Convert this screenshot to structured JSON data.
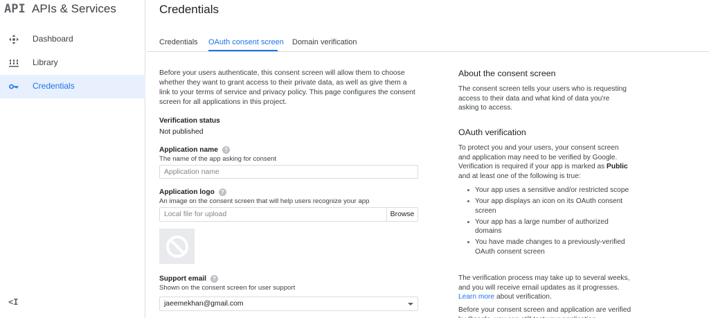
{
  "brand": {
    "logo": "API",
    "title": "APIs & Services"
  },
  "sidebar": {
    "items": [
      {
        "label": "Dashboard",
        "icon": "dashboard-icon"
      },
      {
        "label": "Library",
        "icon": "library-icon"
      },
      {
        "label": "Credentials",
        "icon": "key-icon",
        "active": true
      }
    ],
    "collapse_label": "<I"
  },
  "header": {
    "title": "Credentials"
  },
  "tabs": [
    {
      "label": "Credentials"
    },
    {
      "label": "OAuth consent screen",
      "active": true
    },
    {
      "label": "Domain verification"
    }
  ],
  "form": {
    "intro": "Before your users authenticate, this consent screen will allow them to choose whether they want to grant access to their private data, as well as give them a link to your terms of service and privacy policy. This page configures the consent screen for all applications in this project.",
    "verification_status_label": "Verification status",
    "verification_status_value": "Not published",
    "app_name_label": "Application name",
    "app_name_help": "The name of the app asking for consent",
    "app_name_placeholder": "Application name",
    "app_name_value": "",
    "app_logo_label": "Application logo",
    "app_logo_help": "An image on the consent screen that will help users recognize your app",
    "file_placeholder": "Local file for upload",
    "browse_label": "Browse",
    "support_email_label": "Support email",
    "support_email_help": "Shown on the consent screen for user support",
    "support_email_value": "jaeemekhan@gmail.com",
    "help_glyph": "?"
  },
  "side": {
    "about_title": "About the consent screen",
    "about_text": "The consent screen tells your users who is requesting access to their data and what kind of data you're asking to access.",
    "oauth_title": "OAuth verification",
    "oauth_text_pre": "To protect you and your users, your consent screen and application may need to be verified by Google. Verification is required if your app is marked as ",
    "oauth_text_bold": "Public",
    "oauth_text_post": " and at least one of the following is true:",
    "bullets": [
      "Your app uses a sensitive and/or restricted scope",
      "Your app displays an icon on its OAuth consent screen",
      "Your app has a large number of authorized domains",
      "You have made changes to a previously-verified OAuth consent screen"
    ],
    "process_pre": "The verification process may take up to several weeks, and you will receive email updates as it progresses. ",
    "learn_more": "Learn more",
    "process_post": " about verification.",
    "before_text": "Before your consent screen and application are verified by Google, you can still test your application"
  },
  "colors": {
    "accent": "#1a73e8",
    "active_bg": "#e8f0fe",
    "border": "#dadce0"
  }
}
